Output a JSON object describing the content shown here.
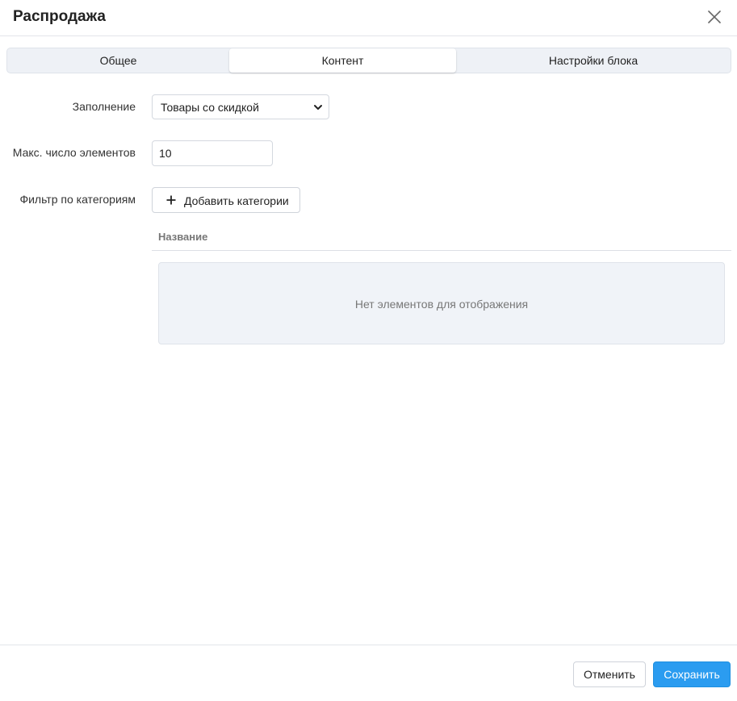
{
  "dialog": {
    "title": "Распродажа"
  },
  "tabs": [
    {
      "label": "Общее",
      "active": false
    },
    {
      "label": "Контент",
      "active": true
    },
    {
      "label": "Настройки блока",
      "active": false
    }
  ],
  "form": {
    "fill": {
      "label": "Заполнение",
      "selected": "Товары со скидкой"
    },
    "max_items": {
      "label": "Макс. число элементов",
      "value": "10"
    },
    "category_filter": {
      "label": "Фильтр по категориям",
      "add_button_label": "Добавить категории"
    }
  },
  "table": {
    "columns": [
      "Название"
    ],
    "empty_text": "Нет элементов для отображения"
  },
  "footer": {
    "cancel_label": "Отменить",
    "save_label": "Сохранить"
  },
  "colors": {
    "primary": "#2b9cf0",
    "tab_bar_bg": "#eef1f6",
    "empty_bg": "#f0f3f8"
  },
  "icons": {
    "close": "close-icon",
    "chevron": "chevron-down-icon",
    "plus": "plus-icon"
  }
}
